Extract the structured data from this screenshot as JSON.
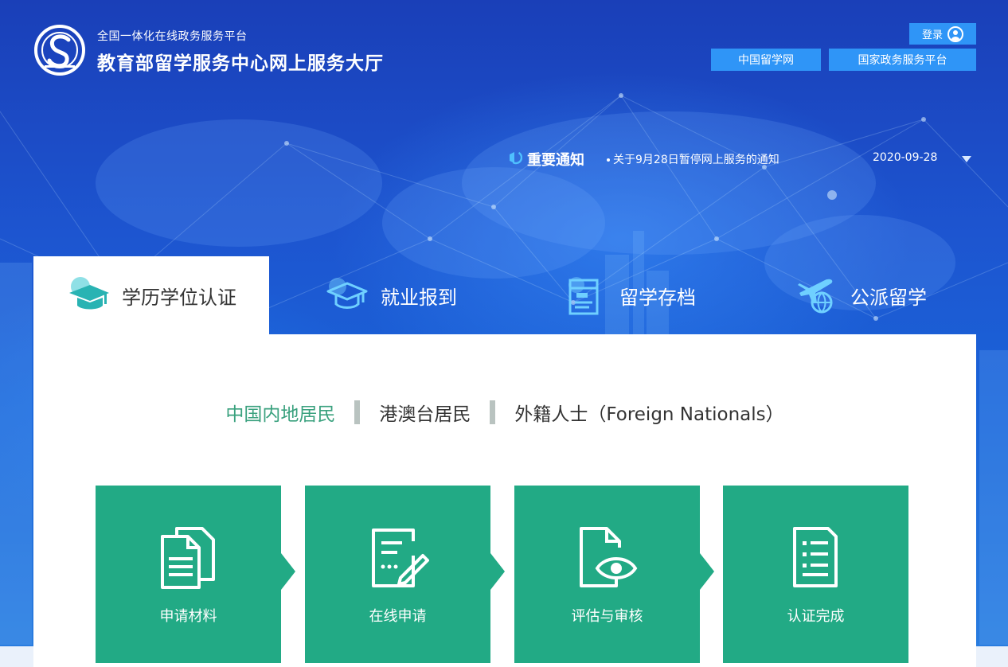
{
  "header": {
    "brand_sub": "全国一体化在线政务服务平台",
    "brand_title": "教育部留学服务中心网上服务大厅",
    "login_label": "登录",
    "links": [
      "中国留学网",
      "国家政务服务平台"
    ]
  },
  "notice": {
    "label": "重要通知",
    "text": "关于9月28日暂停网上服务的通知",
    "date": "2020-09-28"
  },
  "tabs": [
    {
      "label": "学历学位认证",
      "icon": "graduation-cap-icon",
      "active": true
    },
    {
      "label": "就业报到",
      "icon": "mortarboard-outline-icon",
      "active": false
    },
    {
      "label": "留学存档",
      "icon": "archive-document-icon",
      "active": false
    },
    {
      "label": "公派留学",
      "icon": "plane-globe-icon",
      "active": false
    }
  ],
  "subnav": {
    "items": [
      "中国内地居民",
      "港澳台居民",
      "外籍人士（Foreign Nationals）"
    ],
    "active_index": 0
  },
  "steps": [
    {
      "label": "申请材料",
      "icon": "documents-icon"
    },
    {
      "label": "在线申请",
      "icon": "edit-form-icon"
    },
    {
      "label": "评估与审核",
      "icon": "document-eye-icon"
    },
    {
      "label": "认证完成",
      "icon": "checklist-icon"
    }
  ],
  "colors": {
    "accent_blue": "#2f95f7",
    "step_green": "#22aa85",
    "active_subnav": "#3aa17e"
  }
}
